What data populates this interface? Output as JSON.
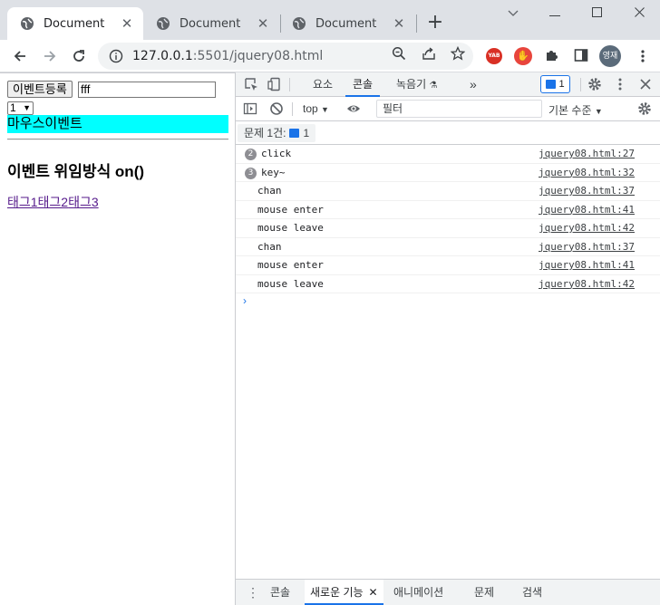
{
  "browser": {
    "tabs": [
      {
        "title": "Document",
        "active": true
      },
      {
        "title": "Document",
        "active": false
      },
      {
        "title": "Document",
        "active": false
      }
    ],
    "url_host": "127.0.0.1",
    "url_rest": ":5501/jquery08.html",
    "ext_yab": "YAB",
    "avatar_text": "영재"
  },
  "page": {
    "event_button": "이벤트등록",
    "text_value": "fff",
    "select_value": "1",
    "mouse_event_text": "마우스이벤트",
    "heading": "이벤트 위임방식 on()",
    "links": [
      "태그1",
      "태그2",
      "태그3"
    ]
  },
  "devtools": {
    "tabs": [
      "요소",
      "콘솔",
      "녹음기"
    ],
    "message_count": "1",
    "context": "top",
    "filter_placeholder": "필터",
    "levels": "기본 수준",
    "issues_label": "문제 1건:",
    "issues_count": "1",
    "logs": [
      {
        "count": "2",
        "message": "click",
        "source": "jquery08.html:27"
      },
      {
        "count": "3",
        "message": "key~",
        "source": "jquery08.html:32"
      },
      {
        "count": "",
        "message": "chan",
        "source": "jquery08.html:37"
      },
      {
        "count": "",
        "message": "mouse enter",
        "source": "jquery08.html:41"
      },
      {
        "count": "",
        "message": "mouse leave",
        "source": "jquery08.html:42"
      },
      {
        "count": "",
        "message": "chan",
        "source": "jquery08.html:37"
      },
      {
        "count": "",
        "message": "mouse enter",
        "source": "jquery08.html:41"
      },
      {
        "count": "",
        "message": "mouse leave",
        "source": "jquery08.html:42"
      }
    ],
    "drawer_tabs": [
      "콘솔",
      "새로운 기능",
      "애니메이션",
      "문제",
      "검색"
    ]
  },
  "colors": {
    "accent": "#1a73e8",
    "mouse_box": "#00ffff",
    "link_visited": "#551a8b"
  }
}
